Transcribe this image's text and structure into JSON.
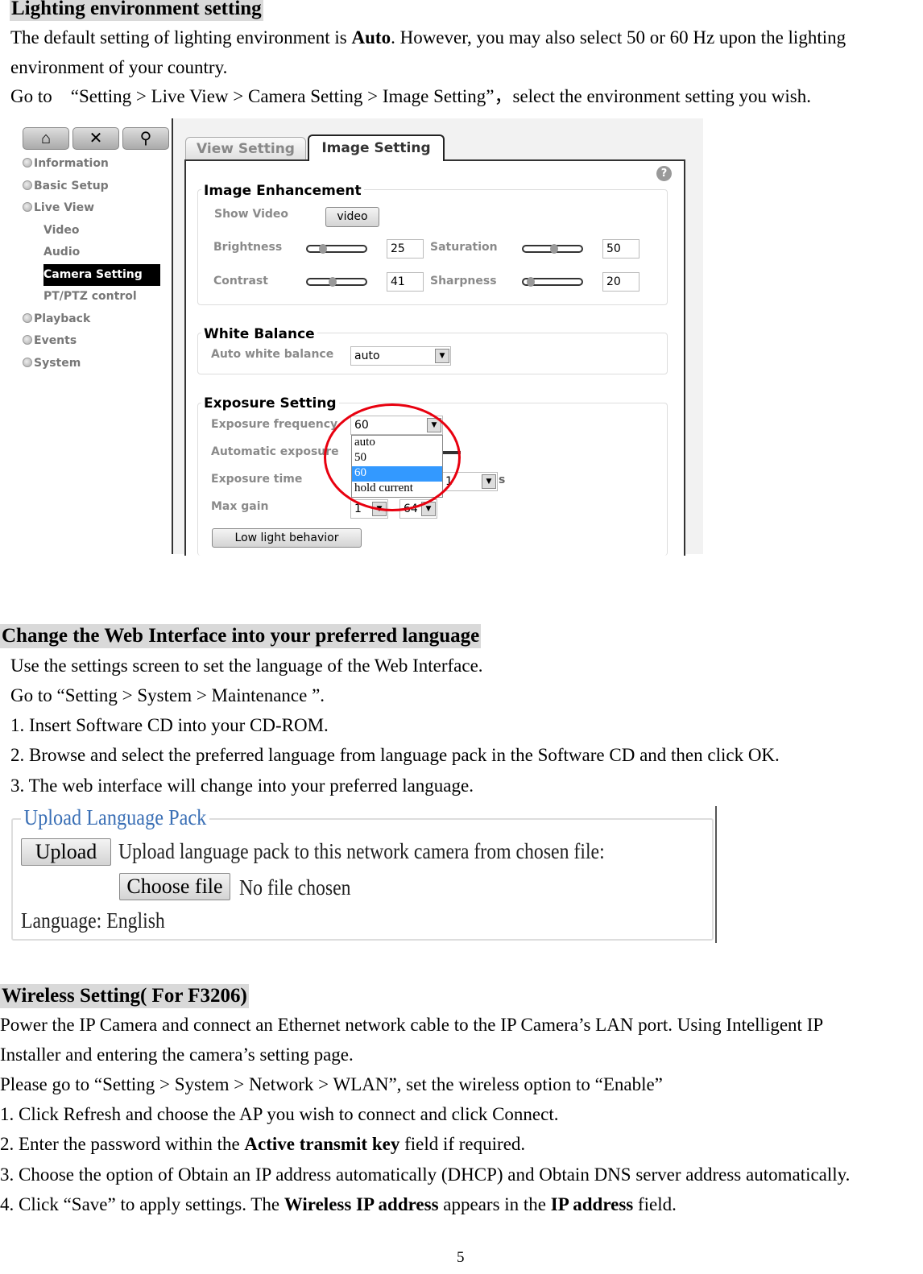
{
  "s1": {
    "heading": "Lighting environment setting",
    "p1a": "The default setting of lighting environment is ",
    "p1b": "Auto",
    "p1c": ". However, you may also select 50 or 60 Hz upon the lighting",
    "p2": "environment of your country.",
    "p3": "Go to　“Setting > Live View > Camera Setting > Image Setting”，select the environment setting you wish."
  },
  "cam": {
    "toolbar": [
      "home-icon",
      "tools-icon",
      "search-icon"
    ],
    "nav": [
      "Information",
      "Basic Setup",
      "Live View",
      "Video",
      "Audio",
      "Camera Setting",
      "PT/PTZ control",
      "Playback",
      "Events",
      "System"
    ],
    "tabs": [
      "View Setting",
      "Image Setting"
    ],
    "image_enhancement": {
      "title": "Image Enhancement",
      "show_video": "Show Video",
      "video_btn": "video",
      "brightness": "Brightness",
      "brightness_val": "25",
      "saturation": "Saturation",
      "saturation_val": "50",
      "contrast": "Contrast",
      "contrast_val": "41",
      "sharpness": "Sharpness",
      "sharpness_val": "20"
    },
    "white_balance": {
      "title": "White Balance",
      "label": "Auto white balance",
      "value": "auto"
    },
    "exposure": {
      "title": "Exposure Setting",
      "freq_label": "Exposure frequency",
      "freq_value": "60",
      "options": [
        "auto",
        "50",
        "60",
        "hold current"
      ],
      "auto_label": "Automatic exposure",
      "time_label": "Exposure time",
      "time_value": "1",
      "time_unit": "s",
      "gain_label": "Max gain",
      "gain_min": "1",
      "gain_max": "64",
      "low_light": "Low light behavior"
    },
    "highlight_color": "#3399ff",
    "circle_color": "#e8000f"
  },
  "s2": {
    "heading": "Change the Web Interface into your preferred language",
    "lines": [
      "Use the settings screen to set the language of the Web Interface.",
      "Go to “Setting > System > Maintenance ”.",
      "1. Insert Software CD into your CD-ROM.",
      "2. Browse and select the preferred language from language pack in the Software CD and then click OK.",
      "3. The web interface will change into your preferred language."
    ]
  },
  "upload": {
    "title": "Upload Language Pack",
    "upload_btn": "Upload",
    "desc": "Upload language pack to this network camera from chosen file:",
    "choose_btn": "Choose file",
    "no_file": "No file chosen",
    "language": "Language: English"
  },
  "s3": {
    "heading": "Wireless Setting( For F3206)",
    "l1": "Power the IP Camera and connect an Ethernet network cable to the IP Camera’s LAN port. Using Intelligent IP",
    "l2": "Installer and entering the camera’s setting page.",
    "l3": "Please go to “Setting > System > Network > WLAN”, set the wireless option to “Enable”",
    "l4": "1. Click Refresh and choose the AP you wish to connect and click Connect.",
    "l5a": "2. Enter the password within the ",
    "l5b": "Active transmit key",
    "l5c": " field if required.",
    "l6": "3. Choose the option of Obtain an IP address automatically (DHCP) and Obtain DNS server address automatically.",
    "l7a": "4. Click “Save” to apply settings. The ",
    "l7b": "Wireless IP address",
    "l7c": " appears in the ",
    "l7d": "IP address",
    "l7e": " field."
  },
  "page_number": "5"
}
